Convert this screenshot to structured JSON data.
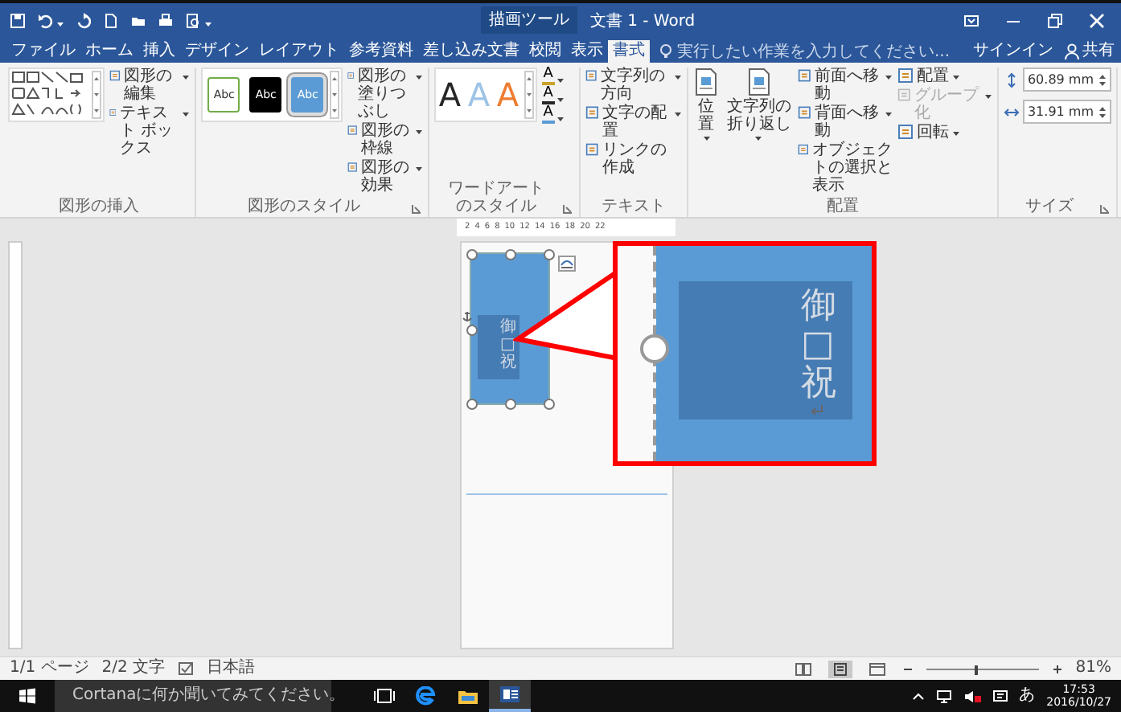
{
  "title_bar": {
    "context_label": "描画ツール",
    "title": "文書 1 - Word"
  },
  "tabs": [
    {
      "label": "ファイル",
      "selected": false
    },
    {
      "label": "ホーム",
      "selected": false
    },
    {
      "label": "挿入",
      "selected": false
    },
    {
      "label": "デザイン",
      "selected": false
    },
    {
      "label": "レイアウト",
      "selected": false
    },
    {
      "label": "参考資料",
      "selected": false
    },
    {
      "label": "差し込み文書",
      "selected": false
    },
    {
      "label": "校閲",
      "selected": false
    },
    {
      "label": "表示",
      "selected": false
    },
    {
      "label": "書式",
      "selected": true
    }
  ],
  "tell_me": {
    "placeholder": "実行したい作業を入力してください..."
  },
  "account": {
    "sign_in": "サインイン",
    "share": "共有"
  },
  "ribbon_groups": [
    {
      "label": "図形の挿入",
      "launcher": false,
      "columns": [
        [
          {
            "kind": "shape_gallery"
          }
        ],
        [
          {
            "kind": "command",
            "label": "図形の編集",
            "dropdown": true,
            "disabled": false
          },
          {
            "kind": "command",
            "label": "テキスト ボックス",
            "dropdown": true,
            "disabled": false
          }
        ]
      ]
    },
    {
      "label": "図形のスタイル",
      "launcher": true,
      "columns": [
        [
          {
            "kind": "swatches",
            "items": [
              {
                "label": "Abc",
                "color": "#ffffff",
                "selected": false
              },
              {
                "label": "Abc",
                "color": "#000000",
                "selected": false
              },
              {
                "label": "Abc",
                "color": "#5b9bd5",
                "selected": true
              }
            ]
          }
        ],
        [
          {
            "kind": "command",
            "label": "図形の塗りつぶし",
            "dropdown": true,
            "disabled": false
          },
          {
            "kind": "command",
            "label": "図形の枠線",
            "dropdown": true,
            "disabled": false
          },
          {
            "kind": "command",
            "label": "図形の効果",
            "dropdown": true,
            "disabled": false
          }
        ]
      ]
    },
    {
      "label": "ワードアートのスタイル",
      "launcher": true,
      "columns": [
        [
          {
            "kind": "wordart",
            "items": [
              {
                "label": "A",
                "color": "#262626"
              },
              {
                "label": "A",
                "color": "#9dc3e6"
              },
              {
                "label": "A",
                "color": "#ed7d31"
              }
            ]
          }
        ],
        [
          {
            "kind": "text_tool",
            "label": "A",
            "color": "#c9a227"
          },
          {
            "kind": "text_tool",
            "label": "A",
            "color": "#262626"
          },
          {
            "kind": "text_tool",
            "label": "A",
            "color": "#5b9bd5"
          }
        ]
      ]
    },
    {
      "label": "テキスト",
      "launcher": false,
      "columns": [
        [
          {
            "kind": "command",
            "label": "文字列の方向",
            "dropdown": true,
            "disabled": false
          },
          {
            "kind": "command",
            "label": "文字の配置",
            "dropdown": true,
            "disabled": false
          },
          {
            "kind": "command",
            "label": "リンクの作成",
            "dropdown": false,
            "disabled": false
          }
        ]
      ]
    },
    {
      "label": "配置",
      "launcher": false,
      "columns": [
        [
          {
            "kind": "large",
            "label": "位置",
            "dropdown": true
          }
        ],
        [
          {
            "kind": "large",
            "label": "文字列の折り返し",
            "dropdown": true
          }
        ],
        [
          {
            "kind": "command",
            "label": "前面へ移動",
            "dropdown": true,
            "disabled": false
          },
          {
            "kind": "command",
            "label": "背面へ移動",
            "dropdown": true,
            "disabled": false
          },
          {
            "kind": "command",
            "label": "オブジェクトの選択と表示",
            "dropdown": false,
            "disabled": false
          }
        ],
        [
          {
            "kind": "command",
            "label": "配置",
            "dropdown": true,
            "disabled": false
          },
          {
            "kind": "command",
            "label": "グループ化",
            "dropdown": true,
            "disabled": true
          },
          {
            "kind": "command",
            "label": "回転",
            "dropdown": true,
            "disabled": false
          }
        ]
      ]
    },
    {
      "label": "サイズ",
      "launcher": true,
      "columns": [
        [
          {
            "kind": "spin",
            "value": "60.89 mm"
          },
          {
            "kind": "spin",
            "value": "31.91 mm"
          }
        ]
      ]
    }
  ],
  "ruler": {
    "ticks": [
      "2",
      "4",
      "6",
      "8",
      "10",
      "12",
      "14",
      "16",
      "18",
      "20",
      "22"
    ]
  },
  "document": {
    "shape_text": "御□祝",
    "callout_text": "御□祝"
  },
  "status_bar": {
    "page": "1/1 ページ",
    "words": "2/2 文字",
    "language": "日本語",
    "views": [
      {
        "kind": "read",
        "selected": false
      },
      {
        "kind": "print",
        "selected": true
      },
      {
        "kind": "web",
        "selected": false
      }
    ],
    "zoom_slider": {
      "level": 0.45
    },
    "zoom": "81%"
  },
  "taskbar": {
    "search_placeholder": "Cortanaに何か聞いてみてください。",
    "apps": [
      {
        "kind": "task_view",
        "active": false
      },
      {
        "kind": "edge",
        "active": false
      },
      {
        "kind": "explorer",
        "active": false
      },
      {
        "kind": "word",
        "active": true
      }
    ],
    "ime": "あ",
    "time": "17:53",
    "date": "2016/10/27"
  }
}
